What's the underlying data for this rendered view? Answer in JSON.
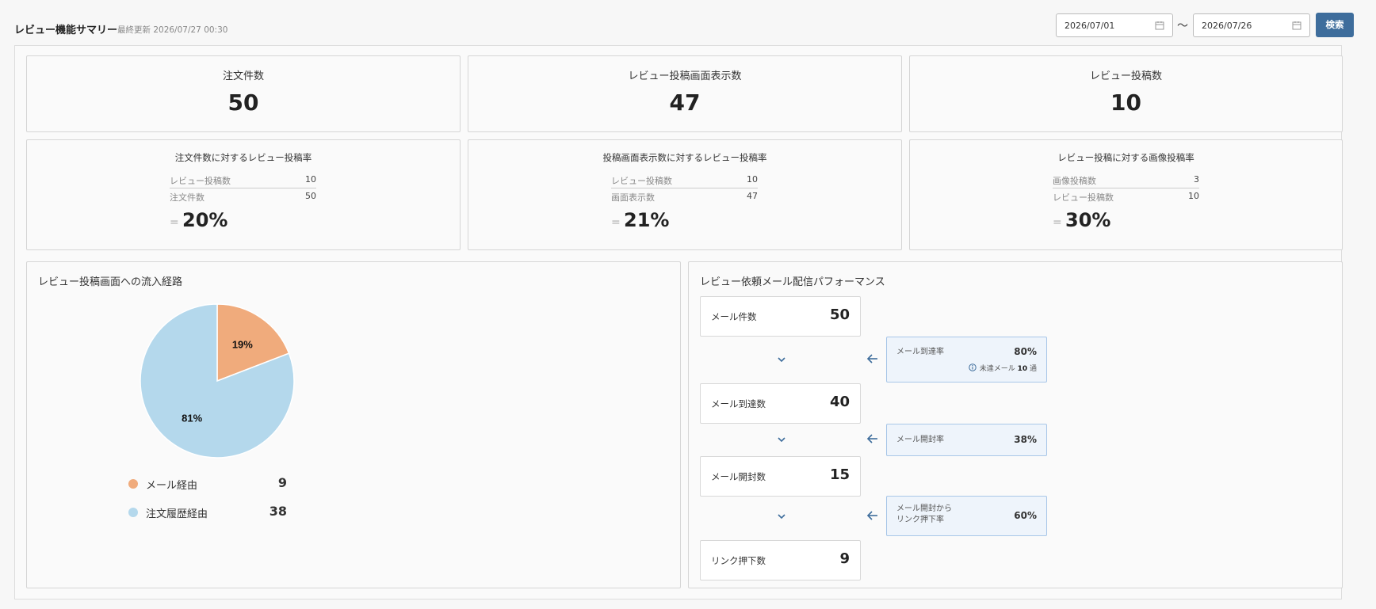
{
  "header": {
    "title": "レビュー機能サマリー",
    "updated": "最終更新 2026/07/27 00:30",
    "date_from": "2026/07/01",
    "date_to": "2026/07/26",
    "separator": "〜",
    "search_label": "検索"
  },
  "kpis": [
    {
      "label": "注文件数",
      "value": "50"
    },
    {
      "label": "レビュー投稿画面表示数",
      "value": "47"
    },
    {
      "label": "レビュー投稿数",
      "value": "10"
    }
  ],
  "rates": [
    {
      "title": "注文件数に対するレビュー投稿率",
      "num_label": "レビュー投稿数",
      "num_value": "10",
      "den_label": "注文件数",
      "den_value": "50",
      "eq": "=",
      "rate": "20%"
    },
    {
      "title": "投稿画面表示数に対するレビュー投稿率",
      "num_label": "レビュー投稿数",
      "num_value": "10",
      "den_label": "画面表示数",
      "den_value": "47",
      "eq": "=",
      "rate": "21%"
    },
    {
      "title": "レビュー投稿に対する画像投稿率",
      "num_label": "画像投稿数",
      "num_value": "3",
      "den_label": "レビュー投稿数",
      "den_value": "10",
      "eq": "=",
      "rate": "30%"
    }
  ],
  "traffic": {
    "title": "レビュー投稿画面への流入経路",
    "slice_labels": [
      "19%",
      "81%"
    ],
    "legend": [
      {
        "label": "メール経由",
        "count": "9",
        "color": "#f0ab7c"
      },
      {
        "label": "注文履歴経由",
        "count": "38",
        "color": "#b4d8ec"
      }
    ]
  },
  "chart_data": {
    "type": "pie",
    "categories": [
      "メール経由",
      "注文履歴経由"
    ],
    "values": [
      9,
      38
    ],
    "percent_labels": [
      "19%",
      "81%"
    ],
    "colors": [
      "#f0ab7c",
      "#b4d8ec"
    ],
    "title": "レビュー投稿画面への流入経路"
  },
  "mail": {
    "title": "レビュー依頼メール配信パフォーマンス",
    "steps": [
      {
        "label": "メール件数",
        "value": "50"
      },
      {
        "label": "メール到達数",
        "value": "40"
      },
      {
        "label": "メール開封数",
        "value": "15"
      },
      {
        "label": "リンク押下数",
        "value": "9"
      }
    ],
    "rates": [
      {
        "label": "メール到達率",
        "value": "80%",
        "note_label": "未達メール",
        "note_count": "10",
        "note_unit": "通"
      },
      {
        "label": "メール開封率",
        "value": "38%"
      },
      {
        "label_line1": "メール開封から",
        "label_line2": "リンク押下率",
        "value": "60%"
      }
    ],
    "accent_color": "#3e6d9c"
  }
}
